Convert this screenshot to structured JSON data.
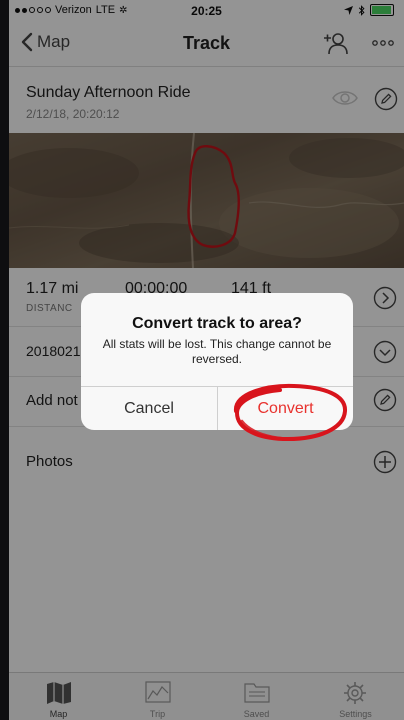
{
  "status_bar": {
    "carrier": "Verizon",
    "network": "LTE",
    "time": "20:25"
  },
  "nav": {
    "back_label": "Map",
    "title": "Track"
  },
  "track": {
    "name": "Sunday Afternoon Ride",
    "date": "2/12/18, 20:20:12"
  },
  "stats": {
    "distance_value": "1.17 mi",
    "distance_label": "DISTANC",
    "time_value": "00:00:00",
    "elevation_value": "141 ft"
  },
  "date_row": {
    "value": "2018021"
  },
  "notes_row": {
    "label": "Add not"
  },
  "photos_row": {
    "label": "Photos"
  },
  "alert": {
    "title": "Convert track to area?",
    "message": "All stats will be lost. This change cannot be reversed.",
    "cancel_label": "Cancel",
    "confirm_label": "Convert"
  },
  "tabs": [
    {
      "label": "Map",
      "icon": "map-icon"
    },
    {
      "label": "Trip",
      "icon": "chart-icon"
    },
    {
      "label": "Saved",
      "icon": "folder-icon"
    },
    {
      "label": "Settings",
      "icon": "gear-icon"
    }
  ],
  "colors": {
    "destructive": "#e8322e",
    "annotation": "#d8141c",
    "track_outline": "#c0131a"
  }
}
